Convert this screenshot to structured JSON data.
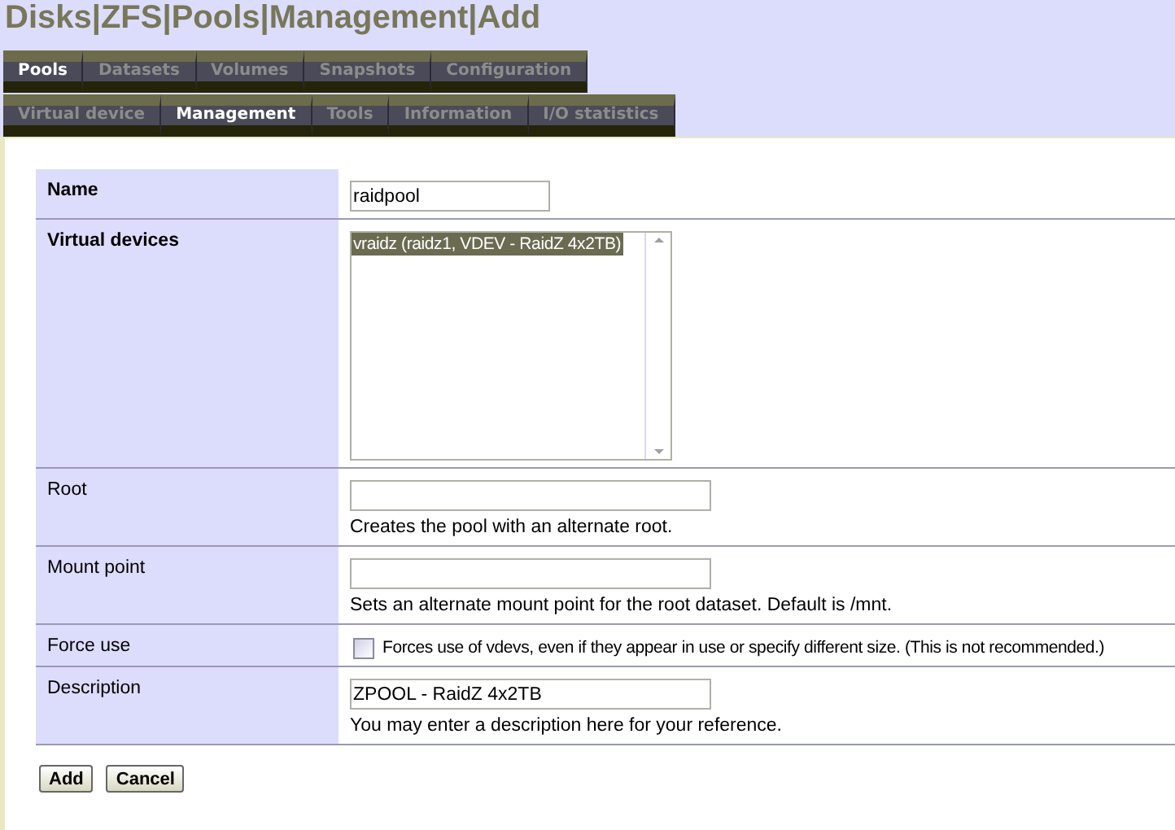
{
  "title": "Disks|ZFS|Pools|Management|Add",
  "tab_rows": [
    [
      {
        "label": "Pools",
        "selected": true
      },
      {
        "label": "Datasets",
        "selected": false
      },
      {
        "label": "Volumes",
        "selected": false
      },
      {
        "label": "Snapshots",
        "selected": false
      },
      {
        "label": "Configuration",
        "selected": false
      }
    ],
    [
      {
        "label": "Virtual device",
        "selected": false
      },
      {
        "label": "Management",
        "selected": true
      },
      {
        "label": "Tools",
        "selected": false
      },
      {
        "label": "Information",
        "selected": false
      },
      {
        "label": "I/O statistics",
        "selected": false
      }
    ]
  ],
  "fields": [
    {
      "kind": "text",
      "label": "Name",
      "required": true,
      "value": "raidpool"
    },
    {
      "kind": "listbox",
      "label": "Virtual devices",
      "required": true,
      "options": [
        {
          "label": "vraidz (raidz1, VDEV - RaidZ 4x2TB)",
          "selected": true
        }
      ]
    },
    {
      "kind": "text",
      "label": "Root",
      "required": false,
      "hint": "Creates the pool with an alternate root."
    },
    {
      "kind": "text",
      "label": "Mount point",
      "required": false,
      "hint": "Sets an alternate mount point for the root dataset. Default is /mnt."
    },
    {
      "kind": "checkbox",
      "label": "Force use",
      "required": false,
      "checked": false,
      "caption": "Forces use of vdevs, even if they appear in use or specify different size. (This is not recommended.)"
    },
    {
      "kind": "text",
      "label": "Description",
      "required": false,
      "value": "ZPOOL - RaidZ 4x2TB",
      "hint": "You may enter a description here for your reference."
    }
  ],
  "buttons": [
    "Add",
    "Cancel"
  ]
}
